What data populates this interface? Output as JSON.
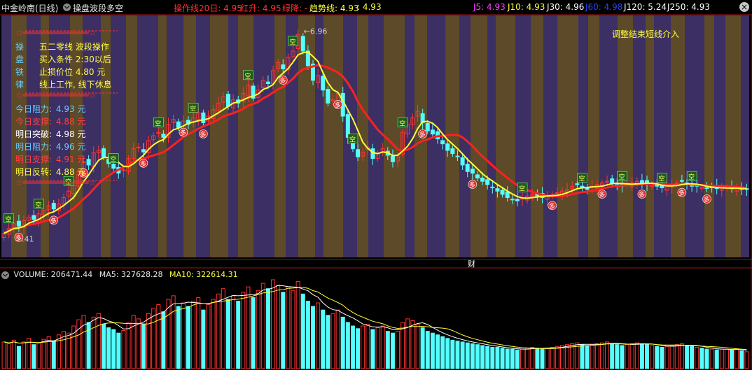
{
  "header": {
    "stock_title": "中金岭南(日线)",
    "indicator_name": "操盘波段多空",
    "op_line": "操作线20日: 4.95",
    "red_up": "红升: 4.95",
    "green_down": "绿降: -",
    "trend_line": "趋势线: 4.93",
    "colon_value": ": 4.93",
    "j5": "J5: 4.93",
    "j10": "J10: 4.93",
    "j30": "J30: 4.96",
    "j60": "J60: 4.98",
    "j120": "J120: 5.24",
    "j250": "J250: 4.93",
    "close_icon": "×"
  },
  "panel": {
    "stars_line": "☆═════════════☆",
    "rows": [
      {
        "char": "操",
        "text": "五二零线 波段操作"
      },
      {
        "char": "盘",
        "text": "买入条件 2:30以后"
      },
      {
        "char": "铁",
        "text": "止损价位 4.80 元"
      },
      {
        "char": "律",
        "text": "线上工作, 线下休息"
      }
    ],
    "levels": [
      {
        "label": "今日阻力:",
        "value": "4.93 元"
      },
      {
        "label": "今日支撑:",
        "value": "4.88 元"
      },
      {
        "label": "明日突破:",
        "value": "4.98 元"
      },
      {
        "label": "明日阻力:",
        "value": "4.96 元"
      },
      {
        "label": "明日支撑:",
        "value": "4.91 元"
      },
      {
        "label": "明日反转:",
        "value": "4.88 元"
      }
    ]
  },
  "annotations": {
    "top_right_note": "调整结束短线介入",
    "high_label": "6.96",
    "low_label": "4.41",
    "fin_marker": "财",
    "buy_marker": "多",
    "sell_marker": "空"
  },
  "volume": {
    "label": "VOLUME: 206471.44",
    "ma5": "MA5: 327628.28",
    "ma10": "MA10: 322614.31"
  },
  "colors": {
    "bg": "#000000",
    "band_purple": "#3c2f63",
    "band_olive": "#5d4a29",
    "up": "#ff3333",
    "down": "#54ffff",
    "ma_red": "#ff2020",
    "ma_yellow": "#ffff33",
    "grid_red": "#a01515"
  },
  "chart_data": {
    "type": "candlestick",
    "title": "中金岭南(日线)",
    "price_high": 6.96,
    "price_low": 4.41,
    "ylim": [
      4.2,
      7.0
    ],
    "closes": [
      4.46,
      4.52,
      4.58,
      4.55,
      4.62,
      4.66,
      4.63,
      4.7,
      4.74,
      4.8,
      4.76,
      4.82,
      4.9,
      4.98,
      5.05,
      5.22,
      5.34,
      5.3,
      5.45,
      5.48,
      5.4,
      5.32,
      5.26,
      5.2,
      5.24,
      5.38,
      5.5,
      5.52,
      5.46,
      5.6,
      5.66,
      5.7,
      5.64,
      5.8,
      5.86,
      5.76,
      5.84,
      5.8,
      5.88,
      5.94,
      5.82,
      5.9,
      5.98,
      6.06,
      6.14,
      6.02,
      6.1,
      6.06,
      6.18,
      6.28,
      6.12,
      6.22,
      6.34,
      6.3,
      6.46,
      6.56,
      6.48,
      6.62,
      6.7,
      6.9,
      6.7,
      6.52,
      6.34,
      6.4,
      6.22,
      6.06,
      6.1,
      6.18,
      5.9,
      5.64,
      5.5,
      5.4,
      5.46,
      5.52,
      5.38,
      5.44,
      5.5,
      5.42,
      5.34,
      5.4,
      5.7,
      5.8,
      5.88,
      5.96,
      5.82,
      5.72,
      5.68,
      5.62,
      5.56,
      5.48,
      5.44,
      5.4,
      5.3,
      5.22,
      5.2,
      5.14,
      5.1,
      5.06,
      5.02,
      4.98,
      4.94,
      4.9,
      4.88,
      4.86,
      4.9,
      4.92,
      4.94,
      4.92,
      4.9,
      4.92,
      4.94,
      4.96,
      4.98,
      5.0,
      5.04,
      5.06,
      5.02,
      5.0,
      5.04,
      5.06,
      5.08,
      5.1,
      5.08,
      5.06,
      5.04,
      5.06,
      5.08,
      5.1,
      5.08,
      5.06,
      5.06,
      5.04,
      5.02,
      5.04,
      5.06,
      5.08,
      5.1,
      5.06,
      5.04,
      5.04,
      5.03,
      5.02,
      5.02,
      5.01,
      5.02,
      5.02,
      5.01,
      5.02,
      5.0,
      5.0
    ],
    "volumes": [
      0.3,
      0.28,
      0.32,
      0.25,
      0.3,
      0.34,
      0.27,
      0.29,
      0.33,
      0.36,
      0.31,
      0.38,
      0.42,
      0.4,
      0.48,
      0.55,
      0.6,
      0.52,
      0.58,
      0.62,
      0.5,
      0.46,
      0.44,
      0.4,
      0.43,
      0.52,
      0.6,
      0.56,
      0.5,
      0.62,
      0.68,
      0.72,
      0.64,
      0.78,
      0.82,
      0.7,
      0.74,
      0.7,
      0.76,
      0.8,
      0.66,
      0.72,
      0.78,
      0.84,
      0.9,
      0.78,
      0.82,
      0.76,
      0.86,
      0.92,
      0.8,
      0.88,
      0.96,
      0.9,
      1.0,
      0.94,
      0.86,
      0.92,
      0.88,
      0.98,
      0.84,
      0.76,
      0.7,
      0.74,
      0.66,
      0.6,
      0.62,
      0.66,
      0.58,
      0.52,
      0.48,
      0.45,
      0.48,
      0.5,
      0.44,
      0.46,
      0.48,
      0.42,
      0.4,
      0.42,
      0.52,
      0.56,
      0.54,
      0.5,
      0.46,
      0.42,
      0.4,
      0.38,
      0.36,
      0.34,
      0.32,
      0.31,
      0.3,
      0.29,
      0.28,
      0.27,
      0.26,
      0.25,
      0.24,
      0.24,
      0.23,
      0.22,
      0.22,
      0.21,
      0.22,
      0.23,
      0.24,
      0.23,
      0.22,
      0.23,
      0.24,
      0.25,
      0.26,
      0.27,
      0.28,
      0.29,
      0.27,
      0.26,
      0.27,
      0.28,
      0.29,
      0.3,
      0.28,
      0.27,
      0.26,
      0.27,
      0.28,
      0.29,
      0.28,
      0.27,
      0.26,
      0.25,
      0.24,
      0.25,
      0.26,
      0.27,
      0.28,
      0.26,
      0.25,
      0.24,
      0.23,
      0.22,
      0.22,
      0.21,
      0.22,
      0.22,
      0.21,
      0.22,
      0.2,
      0.19
    ],
    "volume_max": 206471.44
  }
}
